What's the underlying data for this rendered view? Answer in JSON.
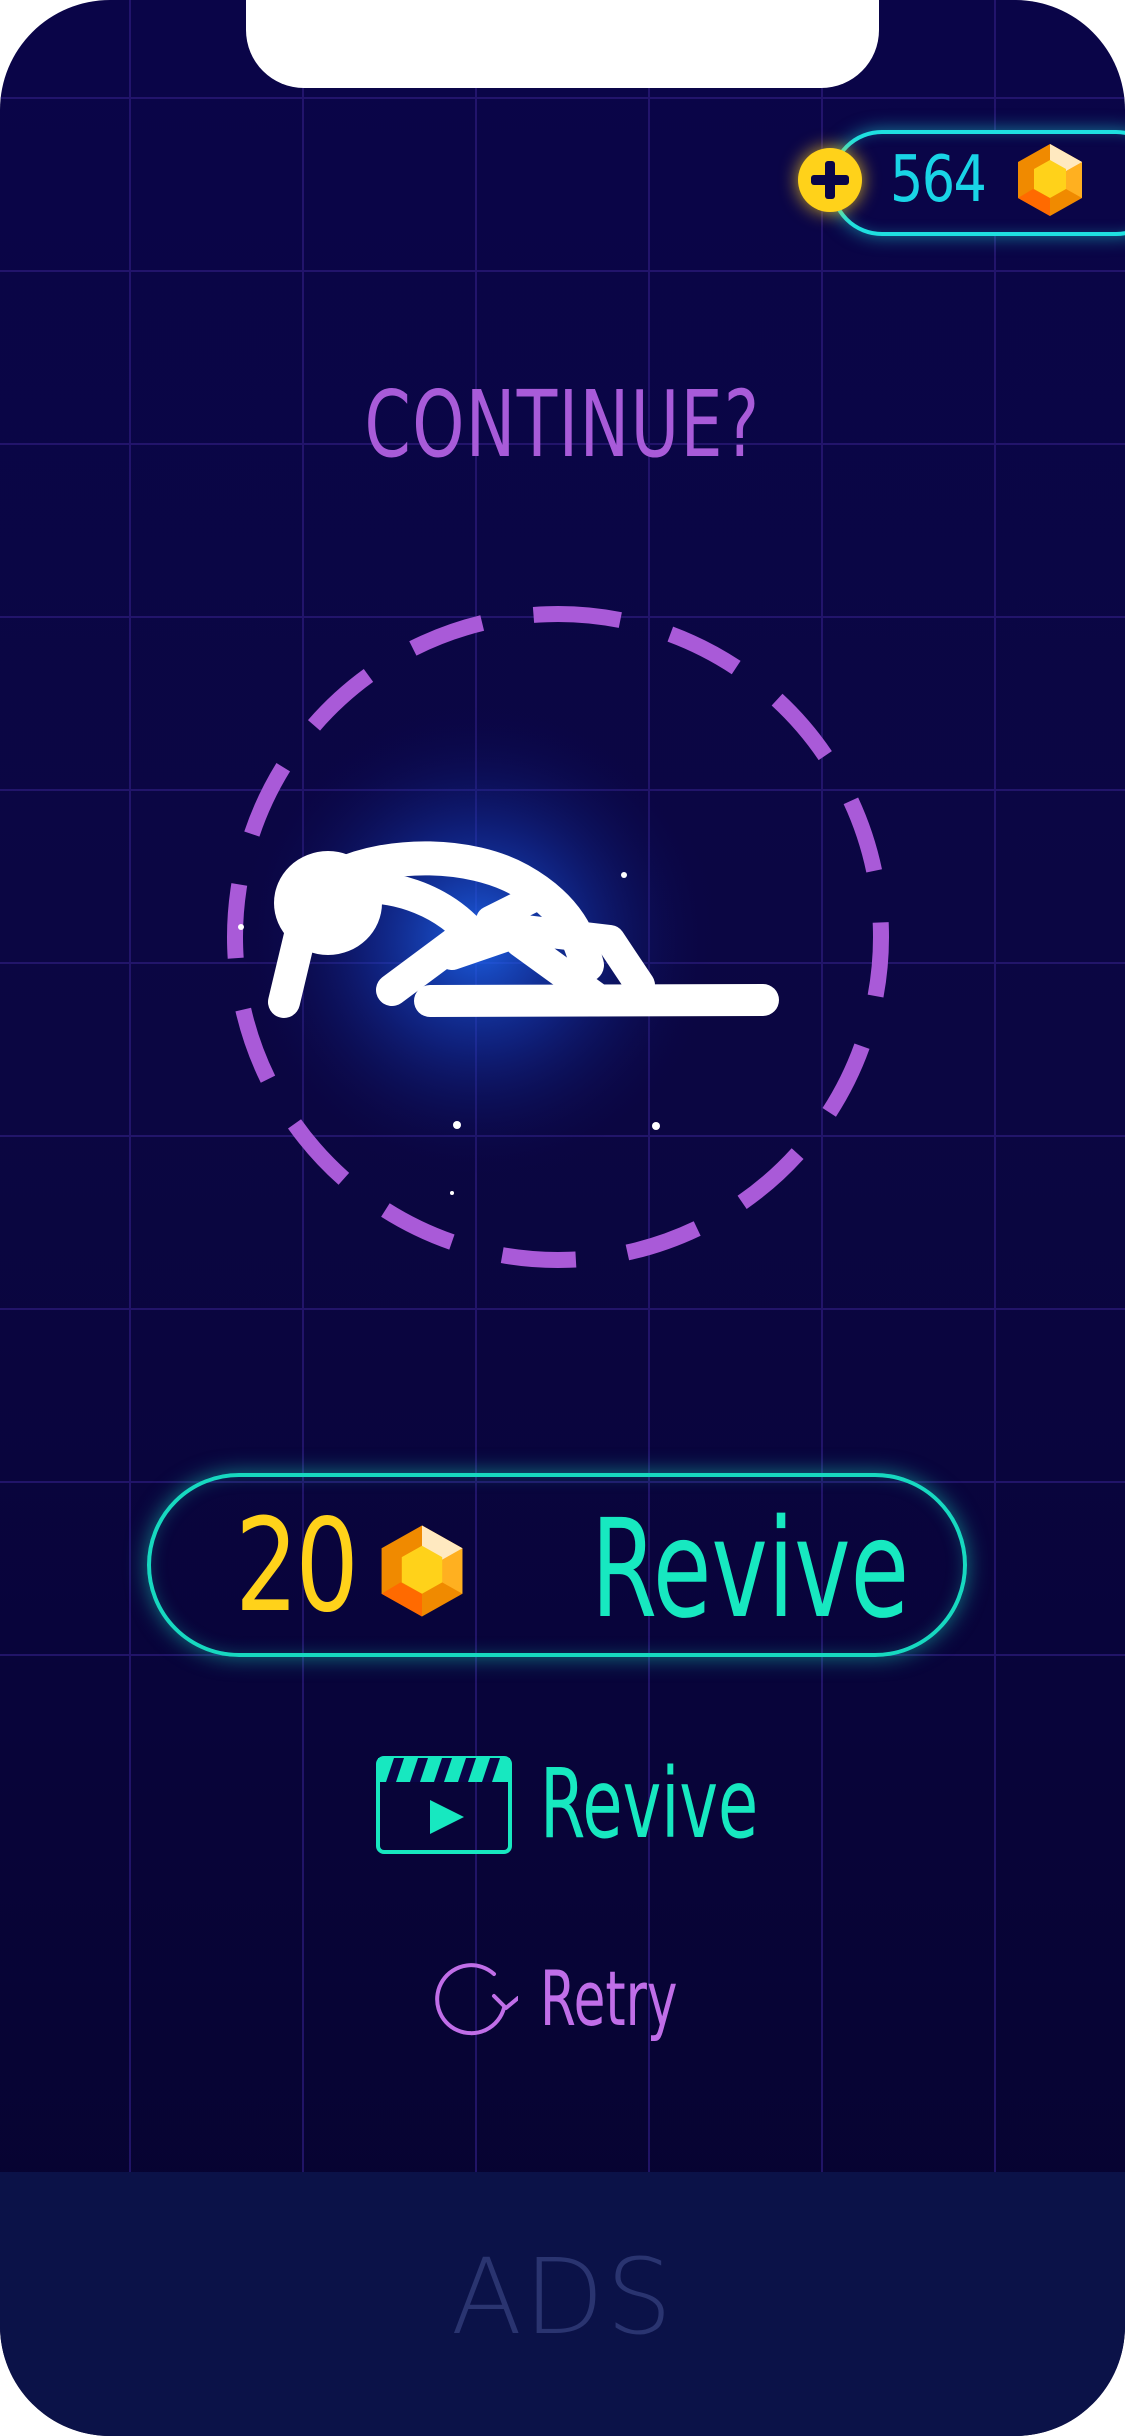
{
  "wallet": {
    "coins": "564",
    "add_icon": "plus-icon",
    "gem_icon": "hexagon-gem-icon"
  },
  "heading": "CONTINUE?",
  "character": {
    "icon": "fallen-stickman-icon",
    "timer": "dashed-countdown-ring"
  },
  "revive_coins": {
    "cost": "20",
    "label": "Revive",
    "gem_icon": "hexagon-gem-icon"
  },
  "revive_ad": {
    "label": "Revive",
    "icon": "video-clapperboard-icon"
  },
  "retry": {
    "label": "Retry",
    "icon": "retry-arrow-icon"
  },
  "ads": {
    "label": "ADS"
  },
  "colors": {
    "background": "#0a0548",
    "accent_cyan": "#17e8c0",
    "coin_yellow": "#ffd21a",
    "purple": "#a85bd9"
  }
}
